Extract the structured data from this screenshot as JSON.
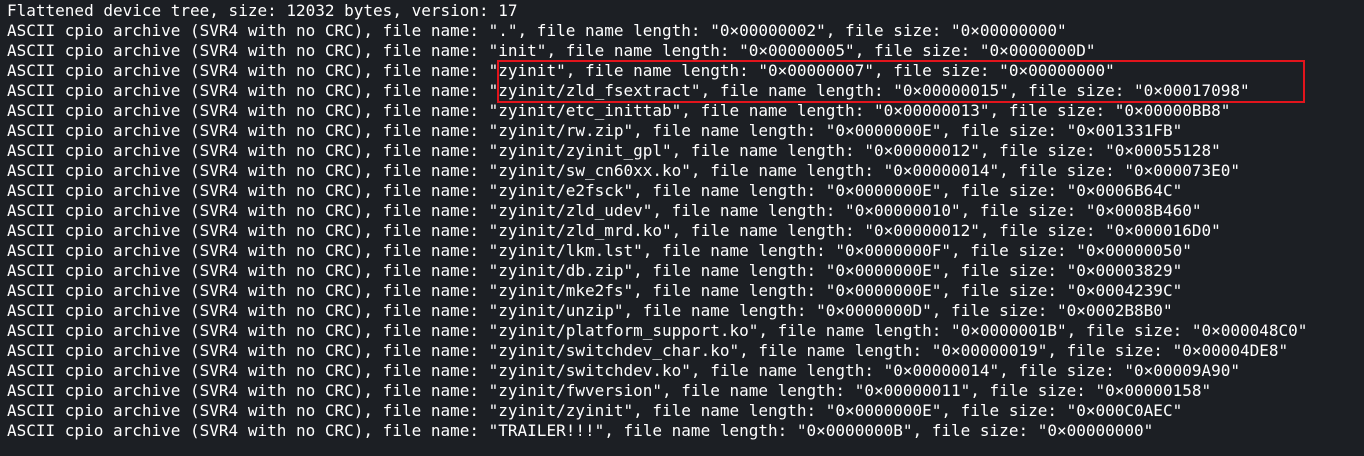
{
  "terminal": {
    "lines": [
      "Flattened device tree, size: 12032 bytes, version: 17",
      "ASCII cpio archive (SVR4 with no CRC), file name: \".\", file name length: \"0×00000002\", file size: \"0×00000000\"",
      "ASCII cpio archive (SVR4 with no CRC), file name: \"init\", file name length: \"0×00000005\", file size: \"0×0000000D\"",
      "ASCII cpio archive (SVR4 with no CRC), file name: \"zyinit\", file name length: \"0×00000007\", file size: \"0×00000000\"",
      "ASCII cpio archive (SVR4 with no CRC), file name: \"zyinit/zld_fsextract\", file name length: \"0×00000015\", file size: \"0×00017098\"",
      "ASCII cpio archive (SVR4 with no CRC), file name: \"zyinit/etc_inittab\", file name length: \"0×00000013\", file size: \"0×00000BB8\"",
      "ASCII cpio archive (SVR4 with no CRC), file name: \"zyinit/rw.zip\", file name length: \"0×0000000E\", file size: \"0×001331FB\"",
      "ASCII cpio archive (SVR4 with no CRC), file name: \"zyinit/zyinit_gpl\", file name length: \"0×00000012\", file size: \"0×00055128\"",
      "ASCII cpio archive (SVR4 with no CRC), file name: \"zyinit/sw_cn60xx.ko\", file name length: \"0×00000014\", file size: \"0×000073E0\"",
      "ASCII cpio archive (SVR4 with no CRC), file name: \"zyinit/e2fsck\", file name length: \"0×0000000E\", file size: \"0×0006B64C\"",
      "ASCII cpio archive (SVR4 with no CRC), file name: \"zyinit/zld_udev\", file name length: \"0×00000010\", file size: \"0×0008B460\"",
      "ASCII cpio archive (SVR4 with no CRC), file name: \"zyinit/zld_mrd.ko\", file name length: \"0×00000012\", file size: \"0×000016D0\"",
      "ASCII cpio archive (SVR4 with no CRC), file name: \"zyinit/lkm.lst\", file name length: \"0×0000000F\", file size: \"0×00000050\"",
      "ASCII cpio archive (SVR4 with no CRC), file name: \"zyinit/db.zip\", file name length: \"0×0000000E\", file size: \"0×00003829\"",
      "ASCII cpio archive (SVR4 with no CRC), file name: \"zyinit/mke2fs\", file name length: \"0×0000000E\", file size: \"0×0004239C\"",
      "ASCII cpio archive (SVR4 with no CRC), file name: \"zyinit/unzip\", file name length: \"0×0000000D\", file size: \"0×0002B8B0\"",
      "ASCII cpio archive (SVR4 with no CRC), file name: \"zyinit/platform_support.ko\", file name length: \"0×0000001B\", file size: \"0×000048C0\"",
      "ASCII cpio archive (SVR4 with no CRC), file name: \"zyinit/switchdev_char.ko\", file name length: \"0×00000019\", file size: \"0×00004DE8\"",
      "ASCII cpio archive (SVR4 with no CRC), file name: \"zyinit/switchdev.ko\", file name length: \"0×00000014\", file size: \"0×00009A90\"",
      "ASCII cpio archive (SVR4 with no CRC), file name: \"zyinit/fwversion\", file name length: \"0×00000011\", file size: \"0×00000158\"",
      "ASCII cpio archive (SVR4 with no CRC), file name: \"zyinit/zyinit\", file name length: \"0×0000000E\", file size: \"0×000C0AEC\"",
      "ASCII cpio archive (SVR4 with no CRC), file name: \"TRAILER!!!\", file name length: \"0×0000000B\", file size: \"0×00000000\""
    ],
    "highlight_color": "#e2141c",
    "background_color": "#1c1f24",
    "text_color": "#ffffff"
  }
}
